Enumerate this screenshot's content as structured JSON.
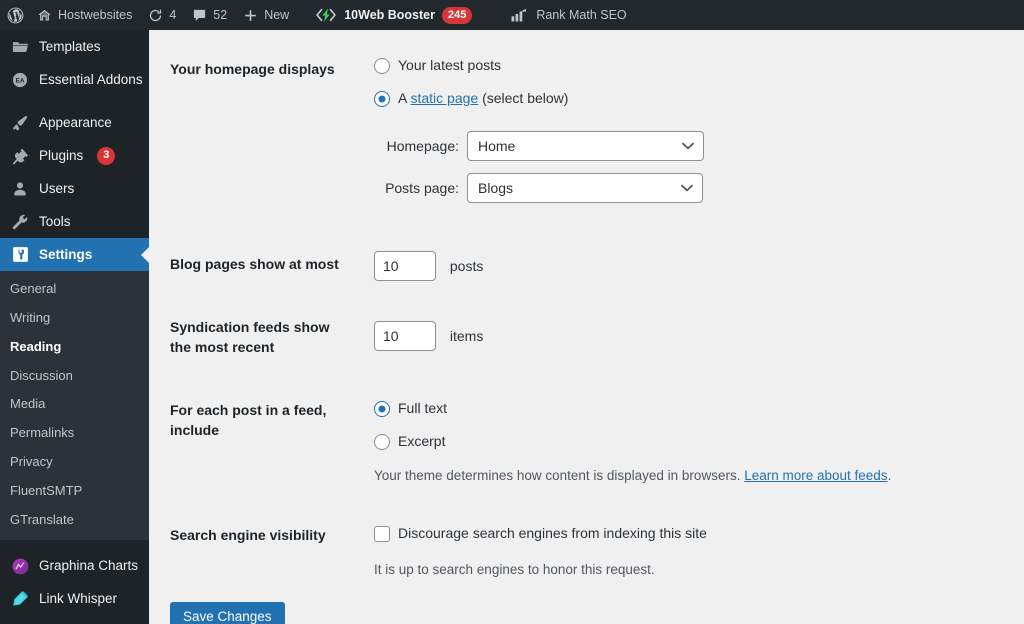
{
  "adminbar": {
    "wp_logo": "wordpress-logo",
    "site": {
      "icon": "home-icon",
      "label": "Hostwebsites"
    },
    "updates": {
      "icon": "updates-icon",
      "count": "4"
    },
    "comments": {
      "icon": "comment-bubble-icon",
      "count": "52"
    },
    "new": {
      "icon": "plus-icon",
      "label": "New"
    },
    "booster": {
      "icon": "lightning-bolt-icon",
      "label": "10Web Booster",
      "badge": "245"
    },
    "rankmath": {
      "icon": "bar-chart-icon",
      "label": "Rank Math SEO"
    }
  },
  "sidebar": {
    "top_items": [
      {
        "label": "Templates",
        "icon": "folder-icon",
        "current": false
      },
      {
        "label": "Essential Addons",
        "icon": "essential-addons-icon",
        "current": false
      }
    ],
    "core_items": [
      {
        "label": "Appearance",
        "icon": "paintbrush-icon",
        "current": false
      },
      {
        "label": "Plugins",
        "icon": "plugin-plug-icon",
        "current": false,
        "badge": "3"
      },
      {
        "label": "Users",
        "icon": "user-icon",
        "current": false
      },
      {
        "label": "Tools",
        "icon": "wrench-icon",
        "current": false
      },
      {
        "label": "Settings",
        "icon": "settings-gear-icon",
        "current": true
      }
    ],
    "submenu": [
      {
        "label": "General",
        "current": false
      },
      {
        "label": "Writing",
        "current": false
      },
      {
        "label": "Reading",
        "current": true
      },
      {
        "label": "Discussion",
        "current": false
      },
      {
        "label": "Media",
        "current": false
      },
      {
        "label": "Permalinks",
        "current": false
      },
      {
        "label": "Privacy",
        "current": false
      },
      {
        "label": "FluentSMTP",
        "current": false
      },
      {
        "label": "GTranslate",
        "current": false
      }
    ],
    "bottom_items": [
      {
        "label": "Graphina Charts",
        "icon": "graphina-chart-icon",
        "current": false
      },
      {
        "label": "Link Whisper",
        "icon": "link-whisper-pen-icon",
        "current": false
      }
    ]
  },
  "settings": {
    "homepage_displays": {
      "label": "Your homepage displays",
      "option_latest": "Your latest posts",
      "option_static_prefix": "A ",
      "option_static_link": "static page",
      "option_static_suffix": " (select below)",
      "selected": "static",
      "homepage_label": "Homepage:",
      "homepage_value": "Home",
      "posts_page_label": "Posts page:",
      "posts_page_value": "Blogs"
    },
    "blog_pages": {
      "label": "Blog pages show at most",
      "value": "10",
      "suffix": "posts"
    },
    "syndication": {
      "label": "Syndication feeds show the most recent",
      "value": "10",
      "suffix": "items"
    },
    "feed_include": {
      "label": "For each post in a feed, include",
      "option_full": "Full text",
      "option_excerpt": "Excerpt",
      "selected": "full",
      "description_prefix": "Your theme determines how content is displayed in browsers. ",
      "description_link": "Learn more about feeds",
      "description_suffix": "."
    },
    "search_visibility": {
      "label": "Search engine visibility",
      "checkbox_label": "Discourage search engines from indexing this site",
      "checked": false,
      "description": "It is up to search engines to honor this request."
    },
    "save_label": "Save Changes"
  },
  "colors": {
    "adminbar_bg": "#23282d",
    "sidebar_bg": "#1d2327",
    "submenu_bg": "#2c3338",
    "accent_blue": "#2271b1",
    "badge_red": "#d63638",
    "content_bg": "#f0f0f1"
  }
}
